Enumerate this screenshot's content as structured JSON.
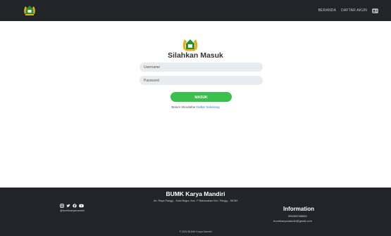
{
  "navbar": {
    "links": [
      "BERANDA",
      "DAFTAR AKUN"
    ],
    "user_icon": "id-card-icon"
  },
  "login": {
    "title": "Silahkan Masuk",
    "username_placeholder": "Username",
    "password_placeholder": "Password",
    "submit_label": "MASUK",
    "register_prefix": "Belum Mendaftar ",
    "register_link": "Daftar Sekarang"
  },
  "footer": {
    "title": "BUMK Karya Mandiri",
    "address": "Jln. Raya Pangg... Kota Bogor, Kec. P Babanakan Kec. Pangg... 56780",
    "social_icons": [
      "instagram-icon",
      "twitter-icon",
      "facebook-icon",
      "youtube-icon"
    ],
    "handle": "@bumkkaryamandiri",
    "info_title": "Information",
    "phone": "085360058860",
    "email": "bumkkaryamandiri@gmail.com",
    "copyright": "© 2024 BUMK Karya Mandiri"
  },
  "colors": {
    "navbar_bg": "#212529",
    "button_green": "#3cc04d",
    "link_blue": "#2b7be4",
    "logo_green": "#2f8f2f",
    "logo_gold": "#e0b21a"
  }
}
